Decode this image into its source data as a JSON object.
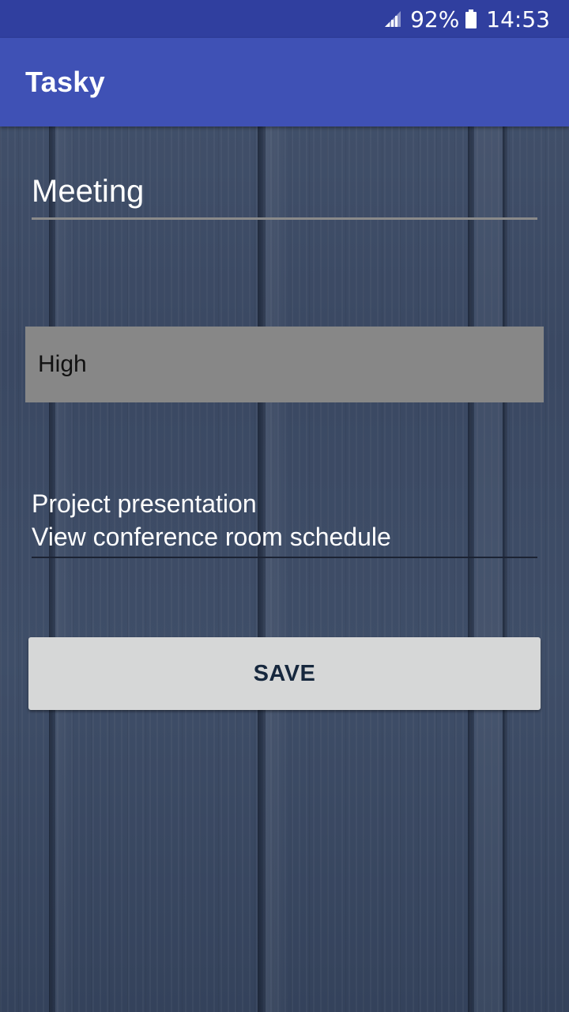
{
  "status_bar": {
    "battery_percent": "92%",
    "time": "14:53",
    "icons": [
      "signal-icon",
      "battery-icon"
    ]
  },
  "app_bar": {
    "title": "Tasky"
  },
  "form": {
    "title_value": "Meeting",
    "priority_value": "High",
    "description_lines": [
      "Project presentation",
      "View conference room schedule"
    ],
    "save_label": "SAVE"
  },
  "colors": {
    "status_bar": "#303f9f",
    "app_bar": "#3f51b5",
    "spinner_bg": "#878787",
    "button_bg": "#d6d7d7",
    "button_text": "#16273d"
  }
}
